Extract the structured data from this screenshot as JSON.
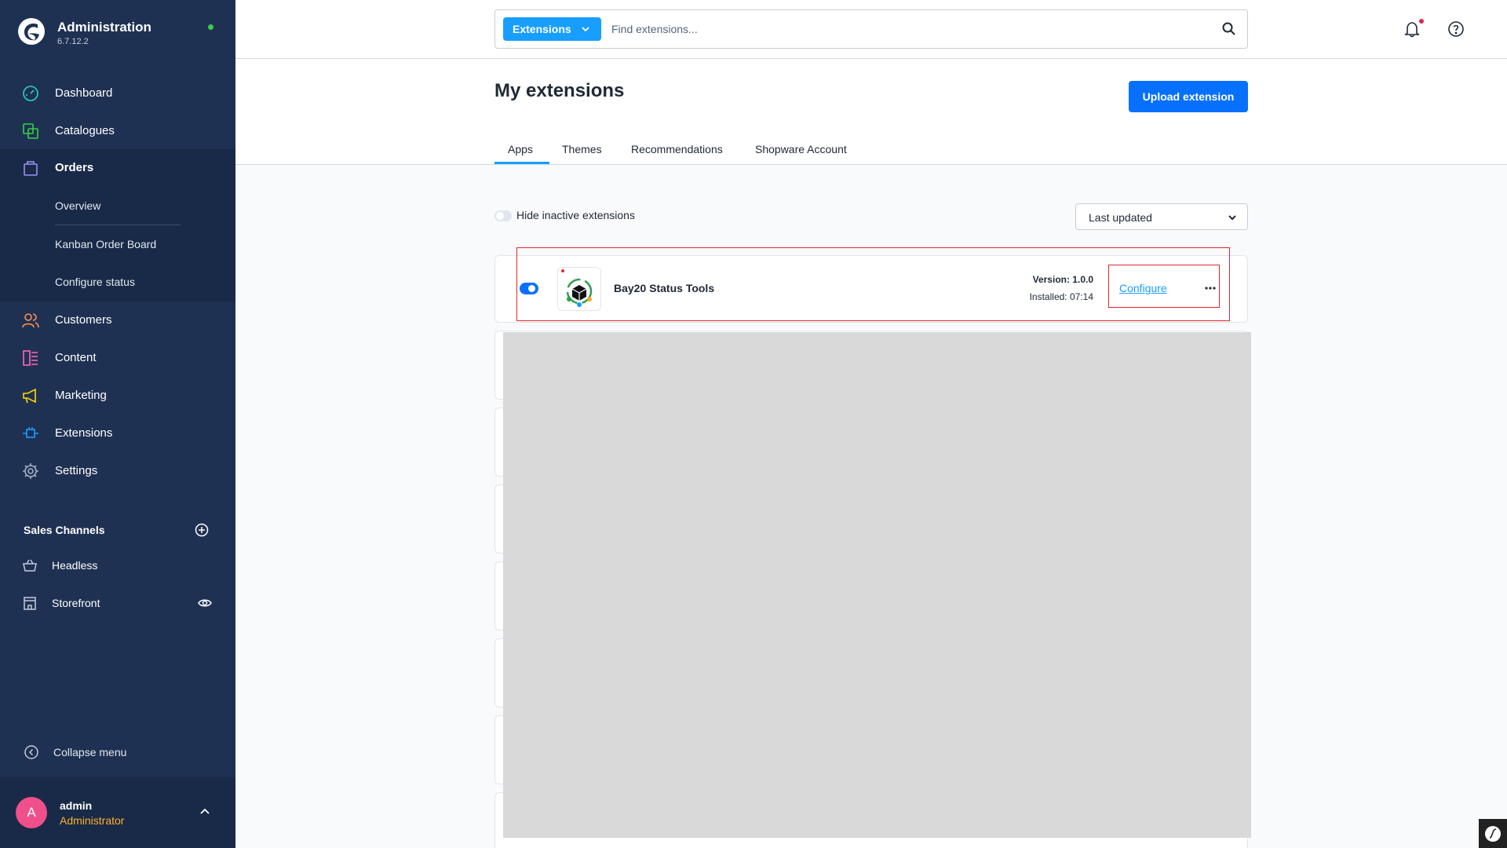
{
  "sidebar": {
    "app_title": "Administration",
    "version": "6.7.12.2",
    "nav": {
      "dashboard": "Dashboard",
      "catalogues": "Catalogues",
      "orders": "Orders",
      "customers": "Customers",
      "content": "Content",
      "marketing": "Marketing",
      "extensions": "Extensions",
      "settings": "Settings"
    },
    "orders_sub": {
      "overview": "Overview",
      "kanban": "Kanban Order Board",
      "configure_status": "Configure status"
    },
    "sales_channels": {
      "title": "Sales Channels",
      "items": [
        "Headless",
        "Storefront"
      ]
    },
    "collapse_label": "Collapse menu",
    "user": {
      "initial": "A",
      "name": "admin",
      "role": "Administrator"
    }
  },
  "topbar": {
    "search_type": "Extensions",
    "search_placeholder": "Find extensions..."
  },
  "page": {
    "title": "My extensions",
    "upload_label": "Upload extension",
    "tabs": [
      "Apps",
      "Themes",
      "Recommendations",
      "Shopware Account"
    ],
    "active_tab": "Apps",
    "hide_inactive_label": "Hide inactive extensions",
    "sort_value": "Last updated"
  },
  "extension": {
    "name": "Bay20 Status Tools",
    "version": "Version: 1.0.0",
    "installed": "Installed: 07:14",
    "configure_label": "Configure",
    "active": true
  },
  "colors": {
    "sidebar_bg": "#1f3152",
    "accent": "#189eff",
    "primary_button": "#0870ff",
    "highlight": "#e3262f"
  }
}
